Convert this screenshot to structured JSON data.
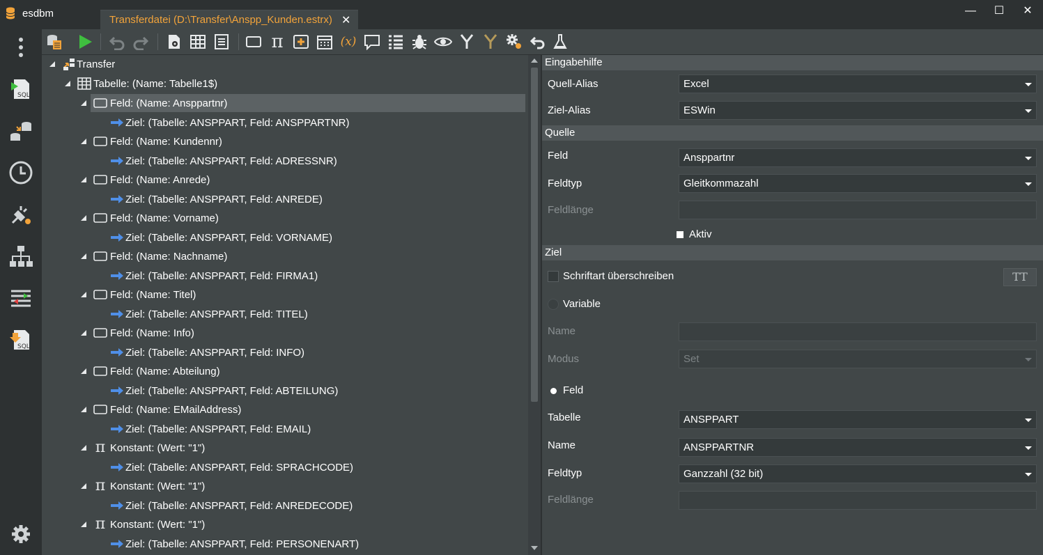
{
  "app": {
    "title": "esdbm"
  },
  "tab": {
    "label": "Transferdatei (D:\\Transfer\\Anspp_Kunden.estrx)",
    "close": "✕"
  },
  "window": {
    "minimize": "—",
    "maximize": "☐",
    "close": "✕"
  },
  "nav": {
    "items": [
      {
        "name": "more-menu-icon"
      },
      {
        "name": "sql-script-icon",
        "label": "SQL"
      },
      {
        "name": "database-transfer-icon"
      },
      {
        "name": "clock-icon"
      },
      {
        "name": "plugin-settings-icon"
      },
      {
        "name": "hierarchy-icon"
      },
      {
        "name": "compare-list-icon"
      },
      {
        "name": "sql-export-icon",
        "label": "SQL"
      }
    ],
    "settings": {
      "name": "gear-icon"
    }
  },
  "toolbar": {
    "buttons": [
      "db-settings-icon",
      "run-icon",
      "undo-icon",
      "redo-icon",
      "document-settings-icon",
      "table-icon",
      "list-icon",
      "field-icon",
      "constant-pi-icon",
      "add-icon",
      "calendar-icon",
      "variable-icon",
      "comment-icon",
      "list-settings-icon",
      "bug-icon",
      "eye-icon",
      "merge-icon",
      "split-icon",
      "settings-icon",
      "return-icon",
      "flask-icon"
    ],
    "variable_glyph": "(x)",
    "pi_glyph": "π"
  },
  "tree": {
    "root": "Transfer",
    "table": "Tabelle: (Name: Tabelle1$)",
    "nodes": [
      {
        "kind": "field",
        "label": "Feld: (Name: Ansppartnr)",
        "target": "Ziel: (Tabelle: ANSPPART, Feld: ANSPPARTNR)",
        "selected": true
      },
      {
        "kind": "field",
        "label": "Feld: (Name: Kundennr)",
        "target": "Ziel: (Tabelle: ANSPPART, Feld: ADRESSNR)"
      },
      {
        "kind": "field",
        "label": "Feld: (Name: Anrede)",
        "target": "Ziel: (Tabelle: ANSPPART, Feld: ANREDE)"
      },
      {
        "kind": "field",
        "label": "Feld: (Name: Vorname)",
        "target": "Ziel: (Tabelle: ANSPPART, Feld: VORNAME)"
      },
      {
        "kind": "field",
        "label": "Feld: (Name: Nachname)",
        "target": "Ziel: (Tabelle: ANSPPART, Feld: FIRMA1)"
      },
      {
        "kind": "field",
        "label": "Feld: (Name: Titel)",
        "target": "Ziel: (Tabelle: ANSPPART, Feld: TITEL)"
      },
      {
        "kind": "field",
        "label": "Feld: (Name: Info)",
        "target": "Ziel: (Tabelle: ANSPPART, Feld: INFO)"
      },
      {
        "kind": "field",
        "label": "Feld: (Name: Abteilung)",
        "target": "Ziel: (Tabelle: ANSPPART, Feld: ABTEILUNG)"
      },
      {
        "kind": "field",
        "label": "Feld: (Name: EMailAddress)",
        "target": "Ziel: (Tabelle: ANSPPART, Feld: EMAIL)"
      },
      {
        "kind": "constant",
        "label": "Konstant: (Wert: \"1\")",
        "target": "Ziel: (Tabelle: ANSPPART, Feld: SPRACHCODE)"
      },
      {
        "kind": "constant",
        "label": "Konstant: (Wert: \"1\")",
        "target": "Ziel: (Tabelle: ANSPPART, Feld: ANREDECODE)"
      },
      {
        "kind": "constant",
        "label": "Konstant: (Wert: \"1\")",
        "target": "Ziel: (Tabelle: ANSPPART, Feld: PERSONENART)"
      }
    ]
  },
  "props": {
    "eingabehilfe": {
      "header": "Eingabehilfe",
      "quell_alias": {
        "label": "Quell-Alias",
        "value": "Excel"
      },
      "ziel_alias": {
        "label": "Ziel-Alias",
        "value": "ESWin"
      }
    },
    "quelle": {
      "header": "Quelle",
      "feld": {
        "label": "Feld",
        "value": "Ansppartnr"
      },
      "feldtyp": {
        "label": "Feldtyp",
        "value": "Gleitkommazahl"
      },
      "feldlaenge": {
        "label": "Feldlänge",
        "value": ""
      },
      "aktiv": {
        "label": "Aktiv",
        "checked": true
      }
    },
    "ziel": {
      "header": "Ziel",
      "schriftart": {
        "label": "Schriftart überschreiben",
        "checked": false,
        "button": "TT"
      },
      "variable": {
        "label": "Variable",
        "selected": false
      },
      "name": {
        "label": "Name",
        "value": ""
      },
      "modus": {
        "label": "Modus",
        "value": "Set"
      },
      "feld_radio": {
        "label": "Feld",
        "selected": true
      },
      "tabelle": {
        "label": "Tabelle",
        "value": "ANSPPART"
      },
      "name2": {
        "label": "Name",
        "value": "ANSPPARTNR"
      },
      "feldtyp": {
        "label": "Feldtyp",
        "value": "Ganzzahl (32 bit)"
      },
      "feldlaenge": {
        "label": "Feldlänge",
        "value": ""
      }
    }
  },
  "colors": {
    "accent": "#f2a33a",
    "run": "#3fbf3f",
    "arrow": "#4f8fe8"
  }
}
